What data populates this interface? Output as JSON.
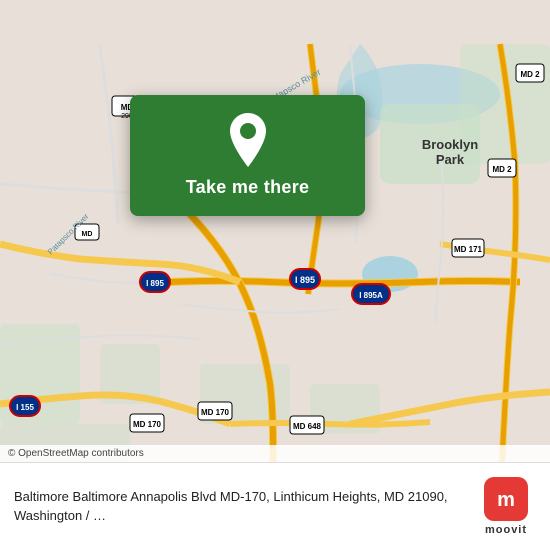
{
  "map": {
    "alt": "Street map of Baltimore area showing MD-170, I-895, MD-295 routes near Linthicum Heights"
  },
  "cta": {
    "button_label": "Take me there",
    "pin_alt": "location-pin"
  },
  "attribution": {
    "text": "© OpenStreetMap contributors"
  },
  "info": {
    "description": "Baltimore Baltimore Annapolis Blvd MD-170, Linthicum Heights, MD 21090, Washington / …"
  },
  "moovit": {
    "label": "moovit"
  },
  "colors": {
    "card_bg": "#2e7d32",
    "moovit_red": "#e53935"
  }
}
